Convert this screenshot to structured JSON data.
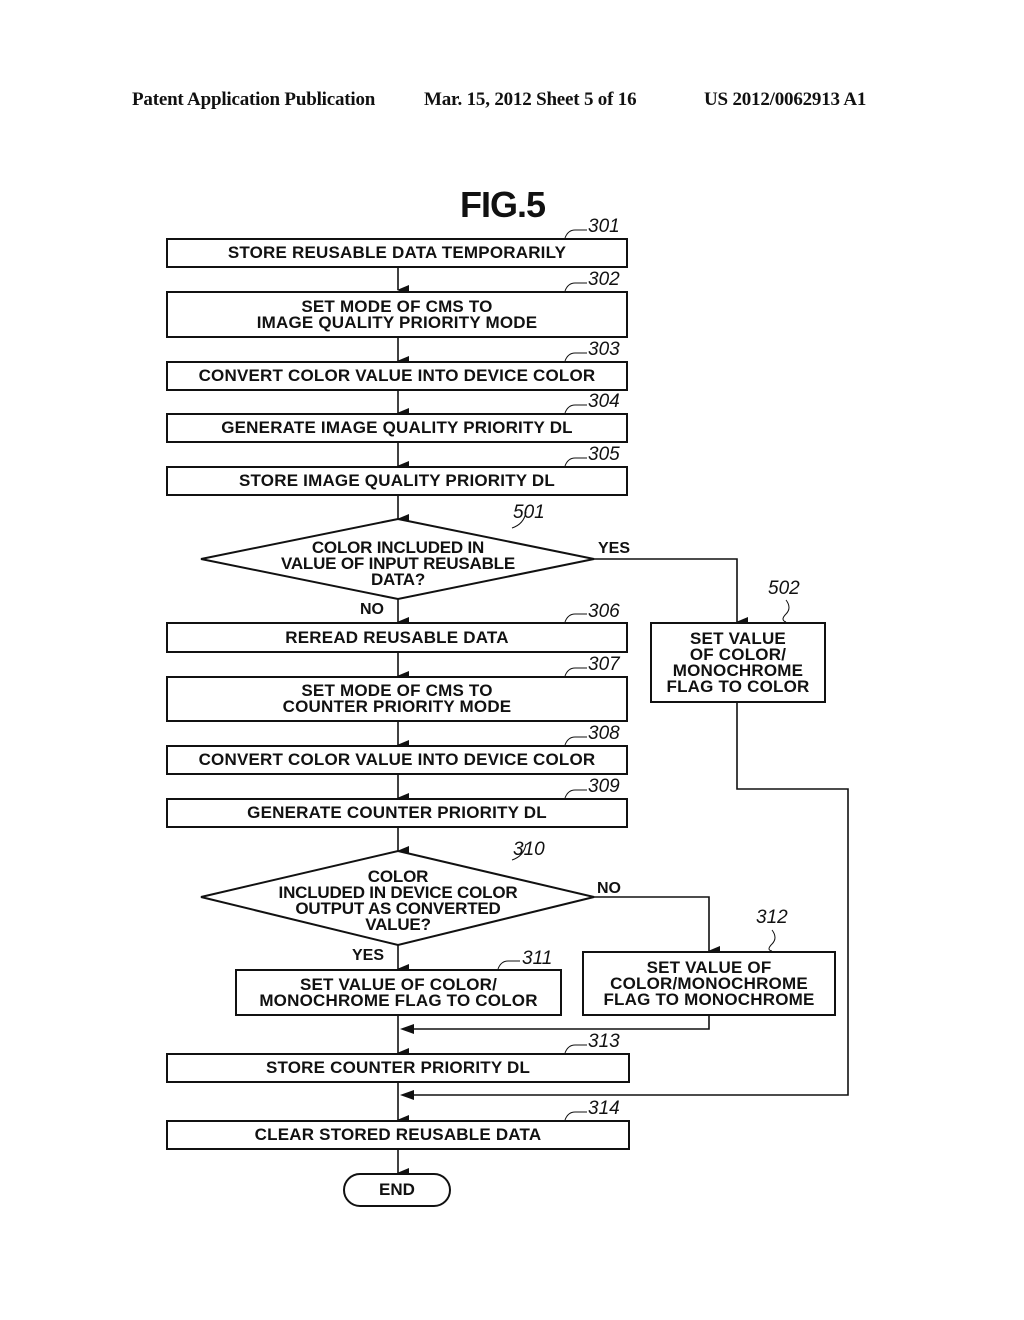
{
  "header": {
    "publication": "Patent Application Publication",
    "date_sheet": "Mar. 15, 2012  Sheet 5 of 16",
    "number": "US 2012/0062913 A1"
  },
  "figure": {
    "title": "FIG.5",
    "steps": {
      "s301": {
        "ref": "301",
        "text": "STORE REUSABLE DATA TEMPORARILY"
      },
      "s302": {
        "ref": "302",
        "text": "SET MODE OF CMS TO\nIMAGE QUALITY PRIORITY MODE"
      },
      "s303": {
        "ref": "303",
        "text": "CONVERT COLOR VALUE INTO DEVICE COLOR"
      },
      "s304": {
        "ref": "304",
        "text": "GENERATE IMAGE QUALITY PRIORITY DL"
      },
      "s305": {
        "ref": "305",
        "text": "STORE IMAGE QUALITY PRIORITY DL"
      },
      "d501": {
        "ref": "501",
        "text": "COLOR INCLUDED IN\nVALUE OF INPUT REUSABLE\nDATA?",
        "yes": "YES",
        "no": "NO"
      },
      "s502": {
        "ref": "502",
        "text": "SET VALUE\nOF COLOR/\nMONOCHROME\nFLAG TO COLOR"
      },
      "s306": {
        "ref": "306",
        "text": "REREAD REUSABLE DATA"
      },
      "s307": {
        "ref": "307",
        "text": "SET MODE OF CMS TO\nCOUNTER PRIORITY MODE"
      },
      "s308": {
        "ref": "308",
        "text": "CONVERT COLOR VALUE INTO DEVICE COLOR"
      },
      "s309": {
        "ref": "309",
        "text": "GENERATE COUNTER PRIORITY DL"
      },
      "d310": {
        "ref": "310",
        "text": "COLOR\nINCLUDED IN DEVICE COLOR\nOUTPUT AS CONVERTED\nVALUE?",
        "yes": "YES",
        "no": "NO"
      },
      "s311": {
        "ref": "311",
        "text": "SET VALUE OF COLOR/\nMONOCHROME FLAG TO COLOR"
      },
      "s312": {
        "ref": "312",
        "text": "SET VALUE OF\nCOLOR/MONOCHROME\nFLAG TO MONOCHROME"
      },
      "s313": {
        "ref": "313",
        "text": "STORE COUNTER PRIORITY DL"
      },
      "s314": {
        "ref": "314",
        "text": "CLEAR STORED REUSABLE DATA"
      },
      "end": {
        "text": "END"
      }
    }
  }
}
